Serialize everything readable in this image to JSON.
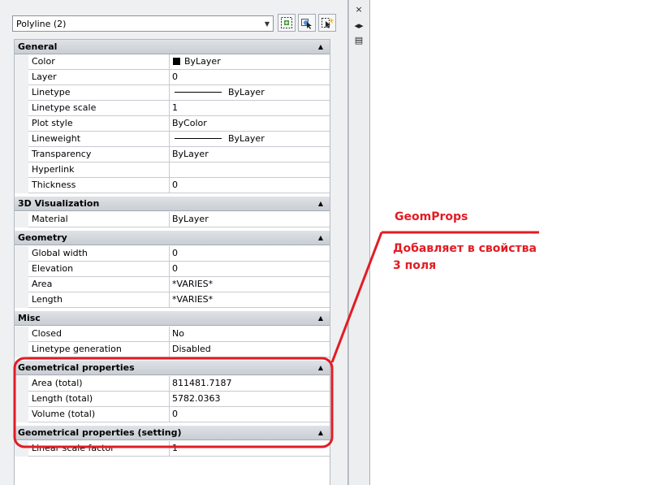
{
  "palette": {
    "selector": {
      "value": "Polyline (2)"
    },
    "tools": {
      "toggle_pickadd": "pickadd-toggle-icon",
      "select_objects": "select-objects-icon",
      "quick_select": "quick-select-icon"
    },
    "strip": {
      "close": "×",
      "autohide": "◂▸",
      "menu": "▤"
    }
  },
  "categories": {
    "general": {
      "title": "General",
      "rows": [
        {
          "name": "Color",
          "value": "ByLayer"
        },
        {
          "name": "Layer",
          "value": "0"
        },
        {
          "name": "Linetype",
          "value": "ByLayer"
        },
        {
          "name": "Linetype scale",
          "value": "1"
        },
        {
          "name": "Plot style",
          "value": "ByColor"
        },
        {
          "name": "Lineweight",
          "value": "ByLayer"
        },
        {
          "name": "Transparency",
          "value": "ByLayer"
        },
        {
          "name": "Hyperlink",
          "value": ""
        },
        {
          "name": "Thickness",
          "value": "0"
        }
      ]
    },
    "viz3d": {
      "title": "3D Visualization",
      "rows": [
        {
          "name": "Material",
          "value": "ByLayer"
        }
      ]
    },
    "geometry": {
      "title": "Geometry",
      "rows": [
        {
          "name": "Global width",
          "value": "0"
        },
        {
          "name": "Elevation",
          "value": "0"
        },
        {
          "name": "Area",
          "value": "*VARIES*"
        },
        {
          "name": "Length",
          "value": "*VARIES*"
        }
      ]
    },
    "misc": {
      "title": "Misc",
      "rows": [
        {
          "name": "Closed",
          "value": "No"
        },
        {
          "name": "Linetype generation",
          "value": "Disabled"
        }
      ]
    },
    "geomprops": {
      "title": "Geometrical properties",
      "rows": [
        {
          "name": "Area (total)",
          "value": "811481.7187"
        },
        {
          "name": "Length (total)",
          "value": "5782.0363"
        },
        {
          "name": "Volume (total)",
          "value": "0"
        }
      ]
    },
    "geomsetting": {
      "title": "Geometrical properties (setting)",
      "rows": [
        {
          "name": "Linear scale factor",
          "value": "1"
        }
      ]
    }
  },
  "annotation": {
    "title": "GeomProps",
    "line1": "Добавляет в свойства",
    "line2": "3 поля",
    "color": "#e31b23"
  }
}
